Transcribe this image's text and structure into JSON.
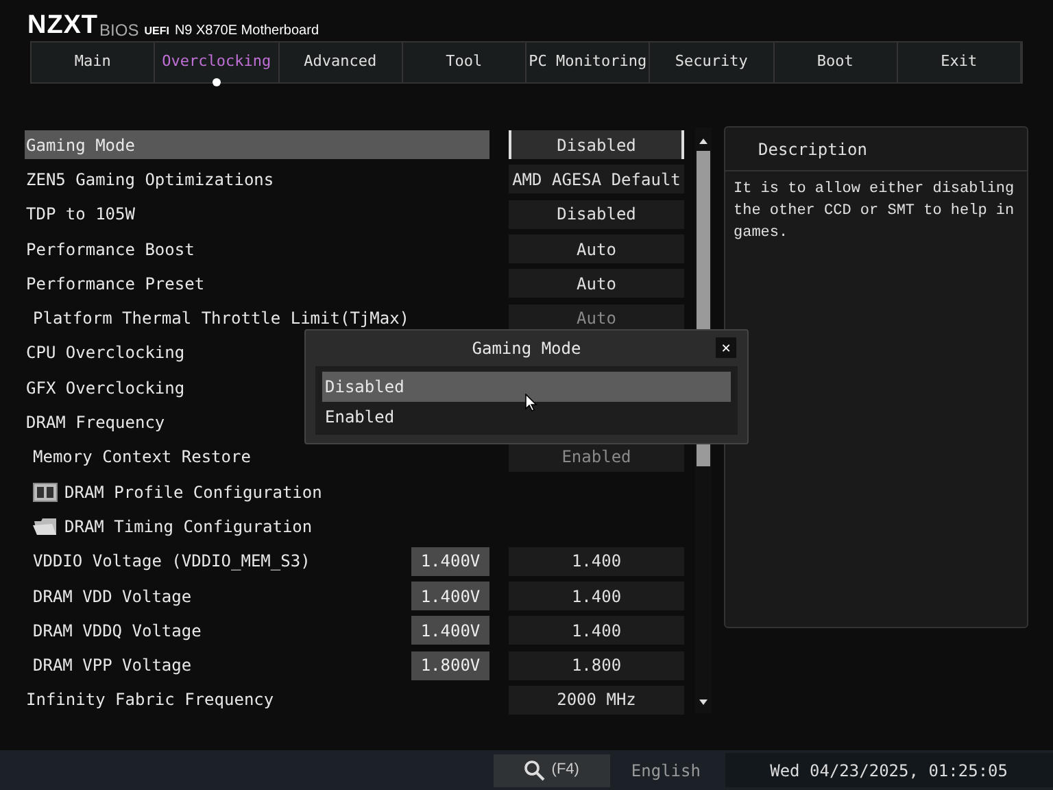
{
  "header": {
    "brand": "NZXT",
    "bios": "BIOS",
    "uefi": "UEFI",
    "model": "N9 X870E Motherboard"
  },
  "tabs": [
    {
      "label": "Main",
      "selected": false
    },
    {
      "label": "Overclocking",
      "selected": true
    },
    {
      "label": "Advanced",
      "selected": false
    },
    {
      "label": "Tool",
      "selected": false
    },
    {
      "label": "PC Monitoring",
      "selected": false
    },
    {
      "label": "Security",
      "selected": false
    },
    {
      "label": "Boot",
      "selected": false
    },
    {
      "label": "Exit",
      "selected": false
    }
  ],
  "settings": [
    {
      "kind": "option",
      "label": "Gaming Mode",
      "value": "Disabled",
      "selected": true
    },
    {
      "kind": "option",
      "label": "ZEN5 Gaming Optimizations",
      "value": "AMD AGESA Default",
      "selected": false
    },
    {
      "kind": "option",
      "label": "TDP to 105W",
      "value": "Disabled",
      "selected": false
    },
    {
      "kind": "option",
      "label": "Performance Boost",
      "value": "Auto",
      "selected": false
    },
    {
      "kind": "option",
      "label": "Performance Preset",
      "value": "Auto",
      "selected": false
    },
    {
      "kind": "option",
      "label": "Platform Thermal Throttle Limit(TjMax)",
      "value": "Auto",
      "selected": false,
      "sub": true,
      "disabled": true
    },
    {
      "kind": "option",
      "label": "CPU Overclocking",
      "selected": false
    },
    {
      "kind": "option",
      "label": "GFX Overclocking",
      "selected": false
    },
    {
      "kind": "option",
      "label": "DRAM Frequency",
      "selected": false
    },
    {
      "kind": "option",
      "label": "Memory Context Restore",
      "value": "Enabled",
      "selected": false,
      "sub": true,
      "disabled": true
    },
    {
      "kind": "profile",
      "label": "DRAM Profile Configuration",
      "selected": false,
      "sub": true
    },
    {
      "kind": "folder",
      "label": "DRAM Timing Configuration",
      "selected": false,
      "sub": true
    },
    {
      "kind": "voltage",
      "label": "VDDIO Voltage (VDDIO_MEM_S3)",
      "reading": "1.400V",
      "value": "1.400",
      "selected": false,
      "sub": true
    },
    {
      "kind": "voltage",
      "label": "DRAM VDD Voltage",
      "reading": "1.400V",
      "value": "1.400",
      "selected": false,
      "sub": true
    },
    {
      "kind": "voltage",
      "label": "DRAM VDDQ Voltage",
      "reading": "1.400V",
      "value": "1.400",
      "selected": false,
      "sub": true
    },
    {
      "kind": "voltage",
      "label": "DRAM VPP Voltage",
      "reading": "1.800V",
      "value": "1.800",
      "selected": false,
      "sub": true
    },
    {
      "kind": "option",
      "label": "Infinity Fabric Frequency",
      "value": "2000 MHz",
      "selected": false
    }
  ],
  "description": {
    "title": "Description",
    "text": "It is to allow either disabling the other CCD or SMT to help in games."
  },
  "popup": {
    "title": "Gaming Mode",
    "close": "✕",
    "options": [
      {
        "label": "Disabled",
        "selected": true
      },
      {
        "label": "Enabled",
        "selected": false
      }
    ]
  },
  "status_bar": {
    "search_key": "(F4)",
    "language": "English",
    "datetime": "Wed 04/23/2025, 01:25:05"
  }
}
